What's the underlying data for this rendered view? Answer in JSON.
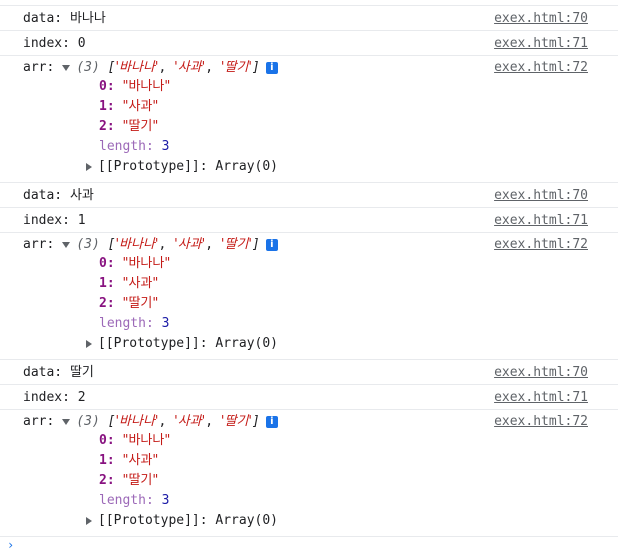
{
  "console": {
    "groups": [
      {
        "data_label": "data:",
        "data_value": "바나나",
        "data_src": "exex.html:70",
        "index_label": "index:",
        "index_value": "0",
        "index_src": "exex.html:71",
        "arr_label": "arr:",
        "arr_src": "exex.html:72",
        "preview_count": "(3)",
        "preview_open": "[",
        "preview_items": [
          "'바나나'",
          "'사과'",
          "'딸기'"
        ],
        "preview_close": "]",
        "info_glyph": "i",
        "props": [
          {
            "key": "0:",
            "value": "\"바나나\""
          },
          {
            "key": "1:",
            "value": "\"사과\""
          },
          {
            "key": "2:",
            "value": "\"딸기\""
          }
        ],
        "length_key": "length:",
        "length_value": "3",
        "proto_text": "[[Prototype]]: Array(0)"
      },
      {
        "data_label": "data:",
        "data_value": "사과",
        "data_src": "exex.html:70",
        "index_label": "index:",
        "index_value": "1",
        "index_src": "exex.html:71",
        "arr_label": "arr:",
        "arr_src": "exex.html:72",
        "preview_count": "(3)",
        "preview_open": "[",
        "preview_items": [
          "'바나나'",
          "'사과'",
          "'딸기'"
        ],
        "preview_close": "]",
        "info_glyph": "i",
        "props": [
          {
            "key": "0:",
            "value": "\"바나나\""
          },
          {
            "key": "1:",
            "value": "\"사과\""
          },
          {
            "key": "2:",
            "value": "\"딸기\""
          }
        ],
        "length_key": "length:",
        "length_value": "3",
        "proto_text": "[[Prototype]]: Array(0)"
      },
      {
        "data_label": "data:",
        "data_value": "딸기",
        "data_src": "exex.html:70",
        "index_label": "index:",
        "index_value": "2",
        "index_src": "exex.html:71",
        "arr_label": "arr:",
        "arr_src": "exex.html:72",
        "preview_count": "(3)",
        "preview_open": "[",
        "preview_items": [
          "'바나나'",
          "'사과'",
          "'딸기'"
        ],
        "preview_close": "]",
        "info_glyph": "i",
        "props": [
          {
            "key": "0:",
            "value": "\"바나나\""
          },
          {
            "key": "1:",
            "value": "\"사과\""
          },
          {
            "key": "2:",
            "value": "\"딸기\""
          }
        ],
        "length_key": "length:",
        "length_value": "3",
        "proto_text": "[[Prototype]]: Array(0)"
      }
    ],
    "prompt_glyph": "›"
  },
  "colors": {
    "string": "#c41a16",
    "key": "#881280",
    "number": "#1a1aa6",
    "link": "#5f6368",
    "info_badge": "#1a73e8"
  }
}
